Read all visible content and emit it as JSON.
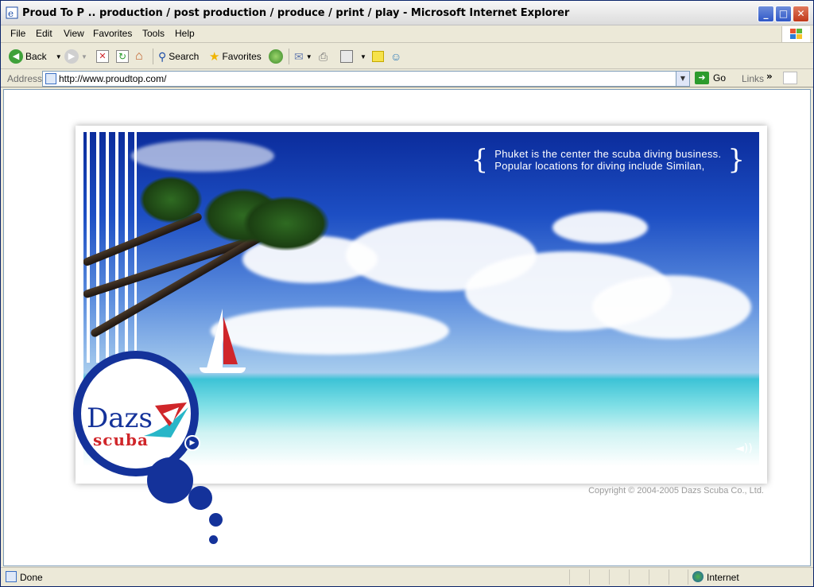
{
  "window": {
    "title": "Proud To P .. production / post production / produce / print / play - Microsoft Internet Explorer"
  },
  "menu": {
    "items": [
      {
        "label": "File"
      },
      {
        "label": "Edit"
      },
      {
        "label": "View"
      },
      {
        "label": "Favorites"
      },
      {
        "label": "Tools"
      },
      {
        "label": "Help"
      }
    ]
  },
  "toolbar": {
    "back_label": "Back",
    "search_label": "Search",
    "favorites_label": "Favorites"
  },
  "address": {
    "label": "Address",
    "url": "http://www.proudtop.com/",
    "go_label": "Go",
    "links_label": "Links"
  },
  "page": {
    "quote_line1": "Phuket is the center the scuba diving business.",
    "quote_line2": "Popular locations for diving include Similan,",
    "logo_word1": "Dazs",
    "logo_word2": "scuba",
    "copyright": "Copyright © 2004-2005 Dazs Scuba Co., Ltd.",
    "brand_blue": "#14329a",
    "brand_red": "#d0262a"
  },
  "status": {
    "text": "Done",
    "zone": "Internet"
  }
}
